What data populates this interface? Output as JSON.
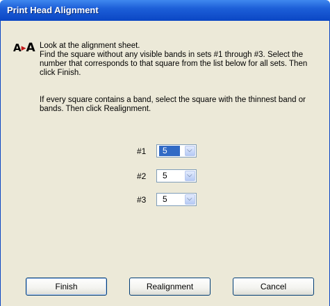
{
  "window": {
    "title": "Print Head Alignment"
  },
  "icon": {
    "name": "text-alignment-icon",
    "left_glyph": "A",
    "right_glyph": "A",
    "triangle": "▶"
  },
  "instructions": {
    "p1": "Look at the alignment sheet.",
    "p2": "Find the square without any visible bands in sets #1 through #3. Select the number that corresponds to that square from the list below for all sets. Then click Finish.",
    "p3": "If every square contains a band, select the square with the thinnest band or bands. Then click Realignment."
  },
  "sets": [
    {
      "label": "#1",
      "value": "5",
      "highlighted": true
    },
    {
      "label": "#2",
      "value": "5",
      "highlighted": false
    },
    {
      "label": "#3",
      "value": "5",
      "highlighted": false
    }
  ],
  "buttons": {
    "finish": "Finish",
    "realignment": "Realignment",
    "cancel": "Cancel"
  },
  "colors": {
    "title_bar": "#0a46c4",
    "dialog_bg": "#ece9d8",
    "selection": "#316ac5"
  }
}
